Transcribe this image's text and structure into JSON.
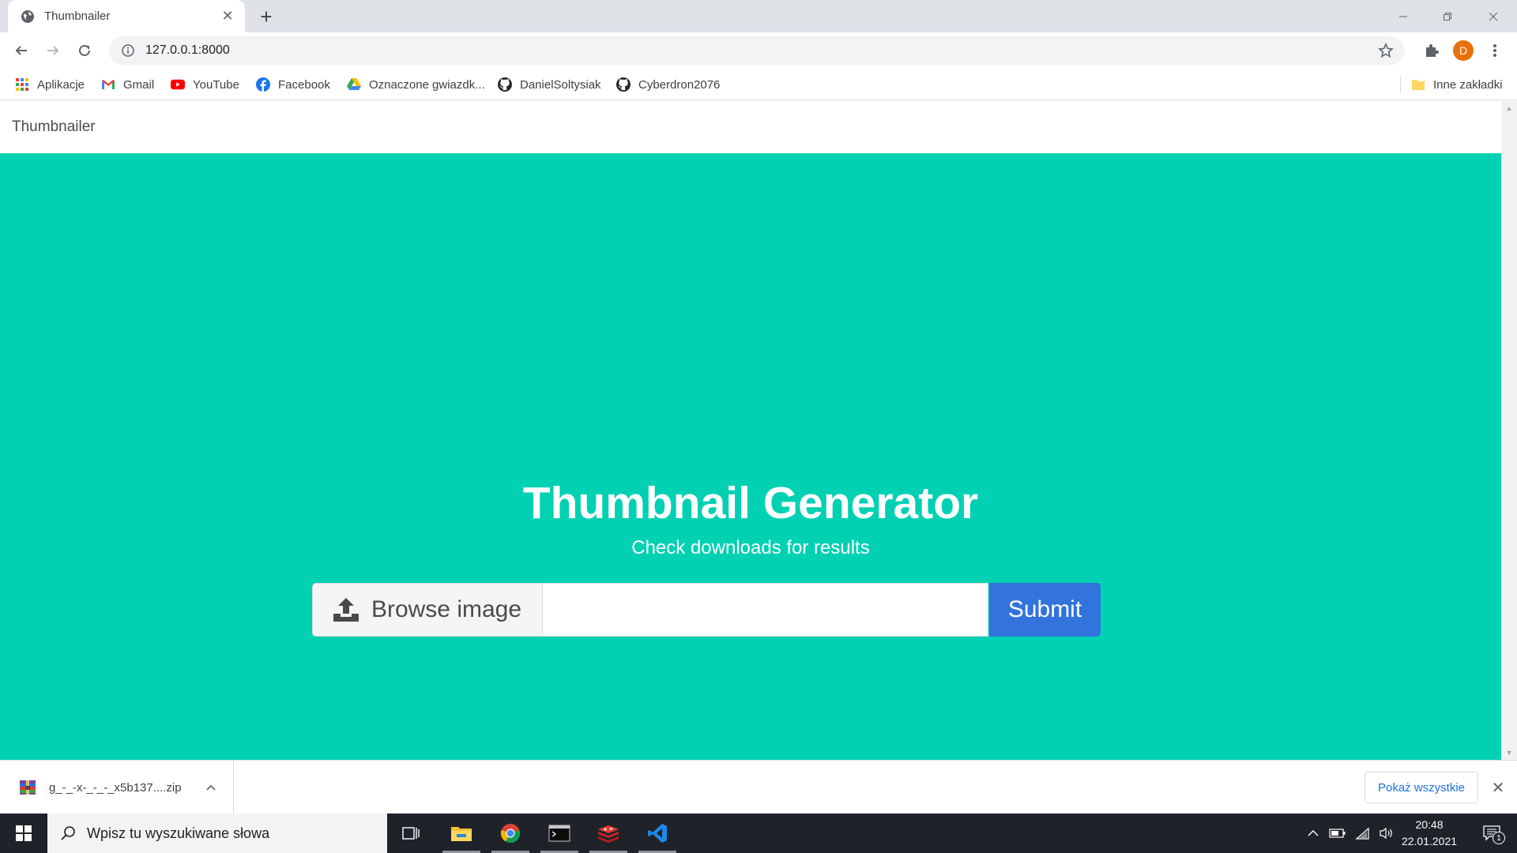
{
  "browser": {
    "tab": {
      "title": "Thumbnailer"
    },
    "address": {
      "url": "127.0.0.1:8000"
    },
    "profile": {
      "initial": "D"
    },
    "bookmarks": [
      {
        "label": "Aplikacje",
        "icon": "apps-grid-icon"
      },
      {
        "label": "Gmail",
        "icon": "gmail-icon"
      },
      {
        "label": "YouTube",
        "icon": "youtube-icon"
      },
      {
        "label": "Facebook",
        "icon": "facebook-icon"
      },
      {
        "label": "Oznaczone gwiazdk...",
        "icon": "google-drive-icon"
      },
      {
        "label": "DanielSoltysiak",
        "icon": "github-icon"
      },
      {
        "label": "Cyberdron2076",
        "icon": "github-icon"
      }
    ],
    "other_bookmarks": {
      "label": "Inne zakładki"
    }
  },
  "page": {
    "navbar": {
      "brand": "Thumbnailer"
    },
    "hero": {
      "title": "Thumbnail Generator",
      "subtitle": "Check downloads for results",
      "browse_label": "Browse image",
      "file_name": "",
      "submit_label": "Submit"
    }
  },
  "downloads": {
    "item": {
      "filename": "g_-_-x-_-_-_x5b137....zip"
    },
    "show_all": "Pokaż wszystkie"
  },
  "taskbar": {
    "search_placeholder": "Wpisz tu wyszukiwane słowa",
    "time": "20:48",
    "date": "22.01.2021",
    "notifications": "1"
  },
  "colors": {
    "hero_bg": "#00d1b2",
    "submit_bg": "#3273dc",
    "avatar_bg": "#e8710a",
    "taskbar_bg": "#1f2229"
  }
}
